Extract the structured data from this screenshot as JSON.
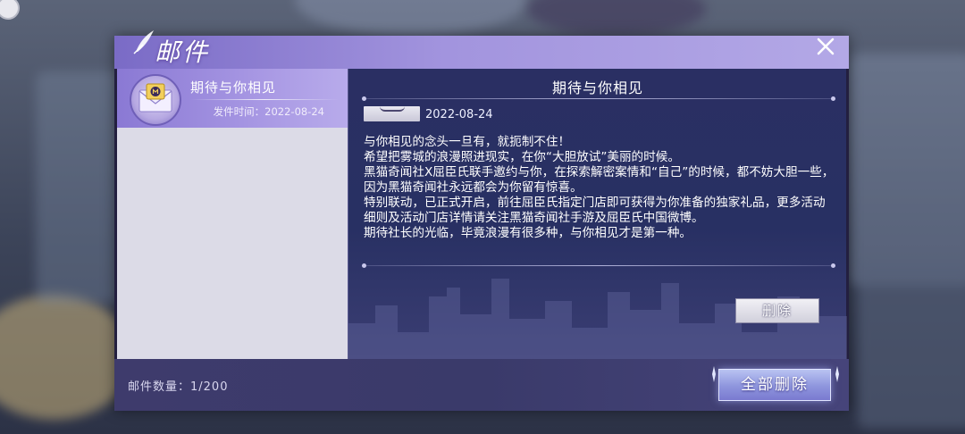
{
  "dialog": {
    "title": "邮件",
    "close_icon": "close-icon"
  },
  "mail_list": {
    "items": [
      {
        "title": "期待与你相见",
        "date": "发件时间：2022-08-24",
        "icon": "envelope-icon",
        "selected": true
      }
    ]
  },
  "content": {
    "title": "期待与你相见",
    "date": "2022-08-24",
    "body": [
      "与你相见的念头一旦有，就扼制不住！",
      "希望把雾城的浪漫照进现实，在你“大胆放试”美丽的时候。",
      "黑猫奇闻社X屈臣氏联手邀约与你，在探索解密案情和“自己”的时候，都不妨大胆一些，因为黑猫奇闻社永远都会为你留有惊喜。",
      "特别联动，已正式开启，前往屈臣氏指定门店即可获得为你准备的独家礼品，更多活动细则及活动门店详情请关注黑猫奇闻社手游及屈臣氏中国微博。",
      "期待社长的光临，毕竟浪漫有很多种，与你相见才是第一种。"
    ],
    "delete_label": "删除"
  },
  "footer": {
    "count_label": "邮件数量：1/200",
    "delete_all_label": "全部删除"
  },
  "colors": {
    "header_gradient_start": "#7a6bc6",
    "panel_dark": "#283063",
    "selected_item": "#a797e3",
    "list_bg": "#dcdbe7"
  }
}
